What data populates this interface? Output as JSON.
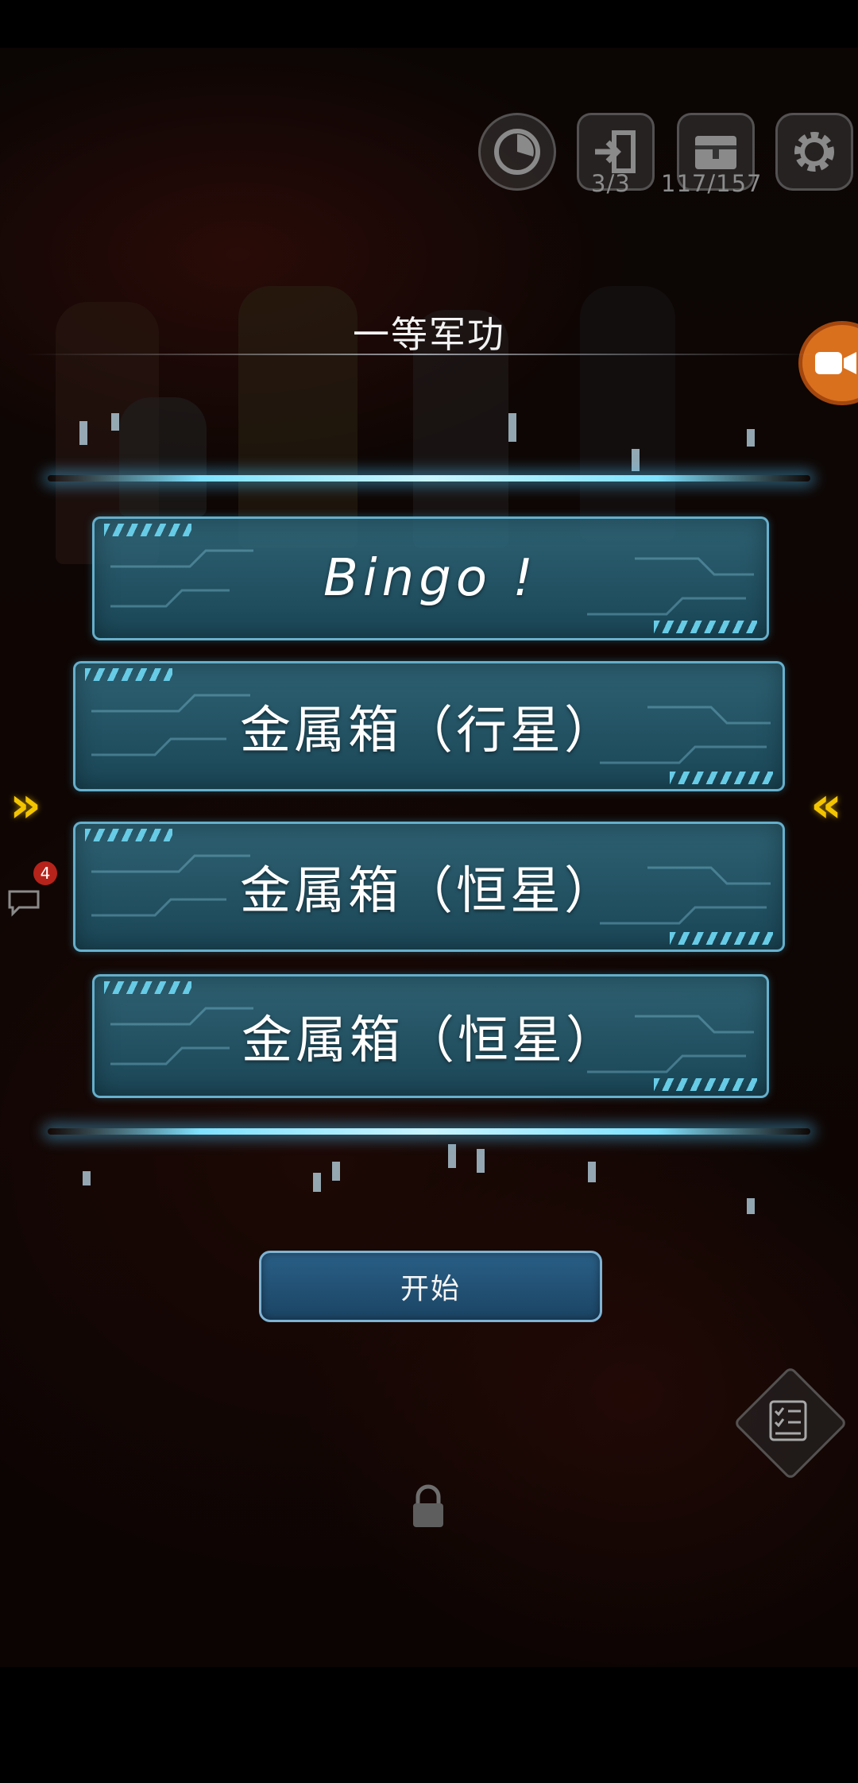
{
  "hud": {
    "stats_button": {
      "icon": "radar-icon"
    },
    "exit_button": {
      "icon": "exit-door-icon",
      "count": "3/3"
    },
    "chest_button": {
      "icon": "treasure-chest-icon",
      "count": "117/157"
    },
    "settings_button": {
      "icon": "gear-icon"
    }
  },
  "dialog": {
    "title": "一等军功",
    "rewards": [
      {
        "label": "Bingo !"
      },
      {
        "label": "金属箱（行星）"
      },
      {
        "label": "金属箱（恒星）"
      },
      {
        "label": "金属箱（恒星）"
      }
    ],
    "start_label": "开始"
  },
  "side": {
    "chat_badge": "4",
    "left_arrow": "»",
    "right_arrow": "«"
  },
  "colors": {
    "card_border": "#6eb9d7",
    "card_fill": "#2f6c82",
    "glow": "#7fe2ff",
    "start_button": "#1f4d6f",
    "chevron": "#f3c400",
    "record": "#d9701e"
  }
}
